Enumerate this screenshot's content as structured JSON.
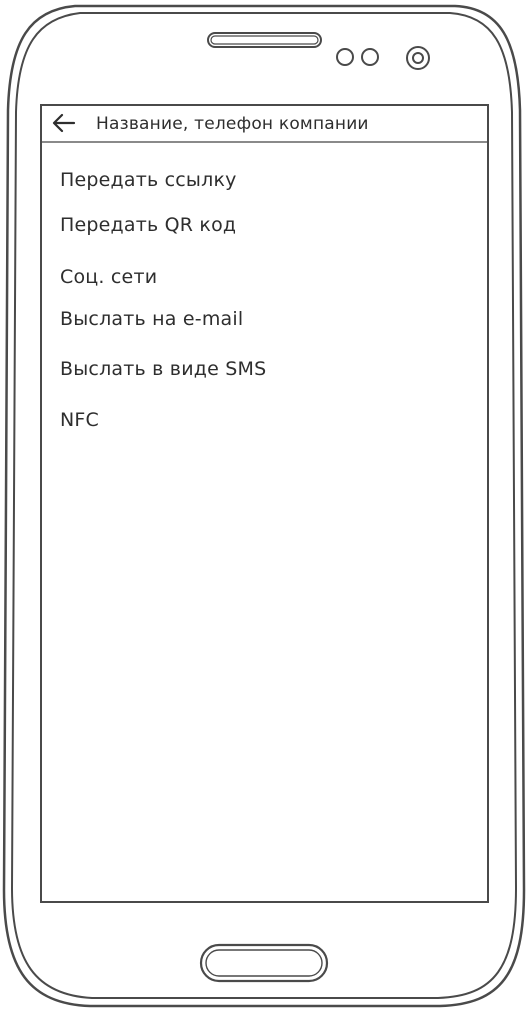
{
  "app_bar": {
    "back_icon": "arrow-left-icon",
    "title": "Название, телефон компании"
  },
  "share_options": [
    {
      "label": "Передать ссылку"
    },
    {
      "label": "Передать QR код"
    },
    {
      "label": "Соц. сети"
    },
    {
      "label": "Выслать на e-mail"
    },
    {
      "label": "Выслать в виде SMS"
    },
    {
      "label": "NFC"
    }
  ],
  "colors": {
    "outline": "#4a4a4a",
    "text": "#2e2e2e"
  }
}
